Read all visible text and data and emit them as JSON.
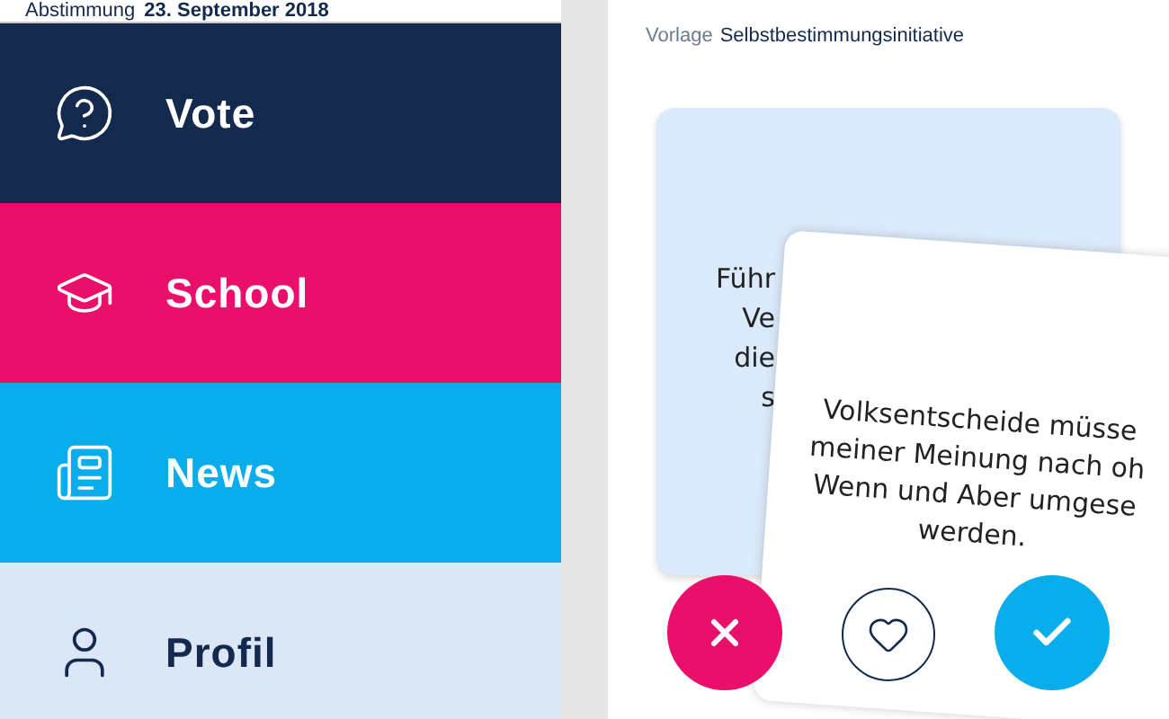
{
  "header": {
    "label": "Abstimmung",
    "date": "23. September 2018"
  },
  "menu": [
    {
      "label": "Vote",
      "color": "#132a4e"
    },
    {
      "label": "School",
      "color": "#ea0f6b"
    },
    {
      "label": "News",
      "color": "#0aadeb"
    },
    {
      "label": "Profil",
      "color": "#dbe7f7"
    }
  ],
  "vorlage": {
    "label": "Vorlage",
    "name": "Selbstbestimmungsinitiative"
  },
  "back_card": {
    "lines": [
      "Führ",
      "Ve",
      "die",
      "s"
    ]
  },
  "front_card": {
    "lines": [
      "Volksentscheide müsse",
      "meiner Meinung nach oh",
      "Wenn und Aber umgese",
      "werden."
    ]
  }
}
